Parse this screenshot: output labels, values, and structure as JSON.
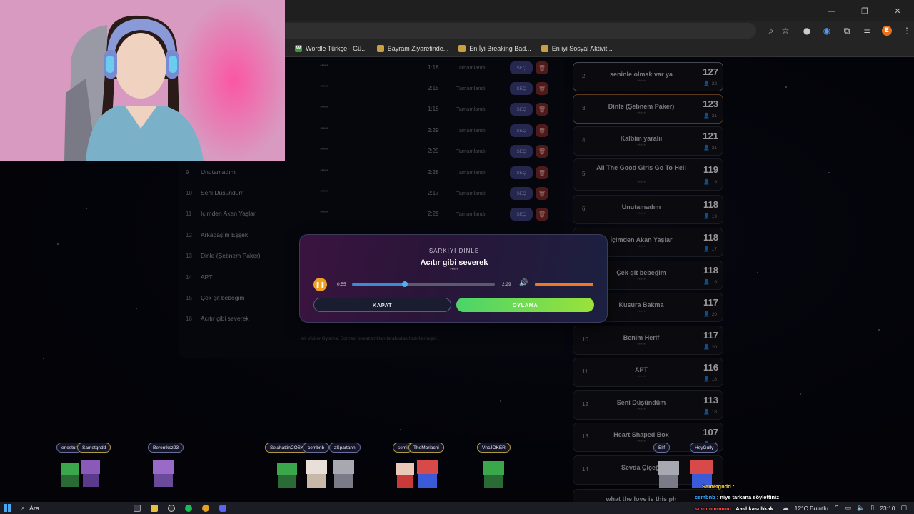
{
  "browser": {
    "window_controls": {
      "minimize": "—",
      "restore": "❐",
      "close": "✕"
    },
    "address_icons": [
      "zoom-icon",
      "star-icon"
    ],
    "profile_initial": "E",
    "bookmarks": [
      {
        "label": "Wordle Türkçe - Gü...",
        "icon": "W",
        "color": "#3c9a3c"
      },
      {
        "label": "Bayram Ziyaretinde...",
        "icon": "",
        "color": "#c8a040"
      },
      {
        "label": "En İyi Breaking Bad...",
        "icon": "",
        "color": "#c8a040"
      },
      {
        "label": "En iyi Sosyal Aktivit...",
        "icon": "",
        "color": "#c8a040"
      }
    ]
  },
  "song_list": {
    "rows": [
      {
        "num": "",
        "title": "",
        "stars": "*****",
        "duration": "1:18",
        "status": "Tamamlandı",
        "select": "SEÇ"
      },
      {
        "num": "",
        "title": "",
        "stars": "*****",
        "duration": "2:15",
        "status": "Tamamlandı",
        "select": "SEÇ"
      },
      {
        "num": "",
        "title": "",
        "stars": "*****",
        "duration": "1:18",
        "status": "Tamamlandı",
        "select": "SEÇ"
      },
      {
        "num": "",
        "title": "",
        "stars": "*****",
        "duration": "2:29",
        "status": "Tamamlandı",
        "select": "SEÇ"
      },
      {
        "num": "",
        "title": "",
        "stars": "*****",
        "duration": "2:29",
        "status": "Tamamlandı",
        "select": "SEÇ"
      },
      {
        "num": "9",
        "title": "Unutamadım",
        "stars": "*****",
        "duration": "2:28",
        "status": "Tamamlandı",
        "select": "SEÇ"
      },
      {
        "num": "10",
        "title": "Seni Düşündüm",
        "stars": "*****",
        "duration": "2:17",
        "status": "Tamamlandı",
        "select": "SEÇ"
      },
      {
        "num": "11",
        "title": "İçimden Akan Yaşlar",
        "stars": "*****",
        "duration": "2:29",
        "status": "Tamamlandı",
        "select": "SEÇ"
      },
      {
        "num": "12",
        "title": "Arkadaşım Eşşek",
        "stars": "",
        "duration": "",
        "status": "",
        "select": ""
      },
      {
        "num": "13",
        "title": "Dinle (Şebnem Paker)",
        "stars": "",
        "duration": "",
        "status": "",
        "select": ""
      },
      {
        "num": "14",
        "title": "APT",
        "stars": "",
        "duration": "",
        "status": "",
        "select": ""
      },
      {
        "num": "15",
        "title": "Çek git bebeğim",
        "stars": "",
        "duration": "",
        "status": "",
        "select": ""
      },
      {
        "num": "16",
        "title": "Acıtır gibi severek",
        "stars": "",
        "duration": "",
        "status": "",
        "select": ""
      }
    ],
    "footer_note": "All Visitor Oylama: Sonraki oneazamktan tarafından hazırlanmıştır."
  },
  "ranking": [
    {
      "pos": "2",
      "title": "seninle olmak var ya",
      "stars": "*****",
      "score": "127",
      "votes": "22"
    },
    {
      "pos": "3",
      "title": "Dinle (Şebnem Paker)",
      "stars": "*****",
      "score": "123",
      "votes": "21"
    },
    {
      "pos": "4",
      "title": "Kalbim yaralıı",
      "stars": "*****",
      "score": "121",
      "votes": "21"
    },
    {
      "pos": "5",
      "title": "All The Good Girls Go To Hell",
      "stars": "*****",
      "score": "119",
      "votes": "19"
    },
    {
      "pos": "6",
      "title": "Unutamadım",
      "stars": "*****",
      "score": "118",
      "votes": "19"
    },
    {
      "pos": "7",
      "title": "İçimden Akan Yaşlar",
      "stars": "*****",
      "score": "118",
      "votes": "17"
    },
    {
      "pos": "8",
      "title": "Çek git bebeğim",
      "stars": "*****",
      "score": "118",
      "votes": "19"
    },
    {
      "pos": "9",
      "title": "Kusura Bakma",
      "stars": "*****",
      "score": "117",
      "votes": "20"
    },
    {
      "pos": "10",
      "title": "Benim Herif",
      "stars": "*****",
      "score": "117",
      "votes": "20"
    },
    {
      "pos": "11",
      "title": "APT",
      "stars": "*****",
      "score": "116",
      "votes": "18"
    },
    {
      "pos": "12",
      "title": "Seni Düşündüm",
      "stars": "*****",
      "score": "113",
      "votes": "18"
    },
    {
      "pos": "13",
      "title": "Heart Shaped Box",
      "stars": "*****",
      "score": "107",
      "votes": "18"
    },
    {
      "pos": "14",
      "title": "Sevda Çiçeği",
      "stars": "*****",
      "score": "",
      "votes": ""
    },
    {
      "pos": "",
      "title": "what the love is this ph",
      "stars": "",
      "score": "",
      "votes": ""
    }
  ],
  "modal": {
    "heading": "ŞARKIYI DİNLE",
    "song_title": "Acıtır gibi severek",
    "stars": "*****",
    "time_current": "0:55",
    "time_total": "2:29",
    "progress": 0.37,
    "volume": 1.0,
    "close_label": "KAPAT",
    "vote_label": "OYLAMA",
    "colors": {
      "play": "#f0a020",
      "progress": "#3a8ad8",
      "volume": "#f07820",
      "vote": "#6adc4a"
    }
  },
  "avatars": [
    {
      "name": "enestur",
      "style": "plain"
    },
    {
      "name": "Sametgndd",
      "style": "gold"
    },
    {
      "name": "Berentksz23",
      "style": "plain"
    },
    {
      "name": "SelahattinCOSK",
      "style": "gold"
    },
    {
      "name": "cembnb",
      "style": "plain"
    },
    {
      "name": "zSpartann",
      "style": "plain"
    },
    {
      "name": "semi",
      "style": "gold"
    },
    {
      "name": "TheMariachi",
      "style": "gold"
    },
    {
      "name": "VncJOKER",
      "style": "gold"
    },
    {
      "name": "Elif",
      "style": "plain"
    },
    {
      "name": "HeyGully",
      "style": "plain"
    }
  ],
  "chat": [
    {
      "user": "Sametgndd",
      "message": ":",
      "color": "#ffd23a"
    },
    {
      "user": "cembnb",
      "message": ": niye tarkana söylettiniz",
      "color": "#3aa8ff"
    },
    {
      "user": "smmmmmmm",
      "message": ": Aashkasdhkak",
      "color": "#ff4a4a"
    }
  ],
  "taskbar": {
    "search": "Ara",
    "weather": "12°C Bulutlu",
    "time": "23:10"
  }
}
